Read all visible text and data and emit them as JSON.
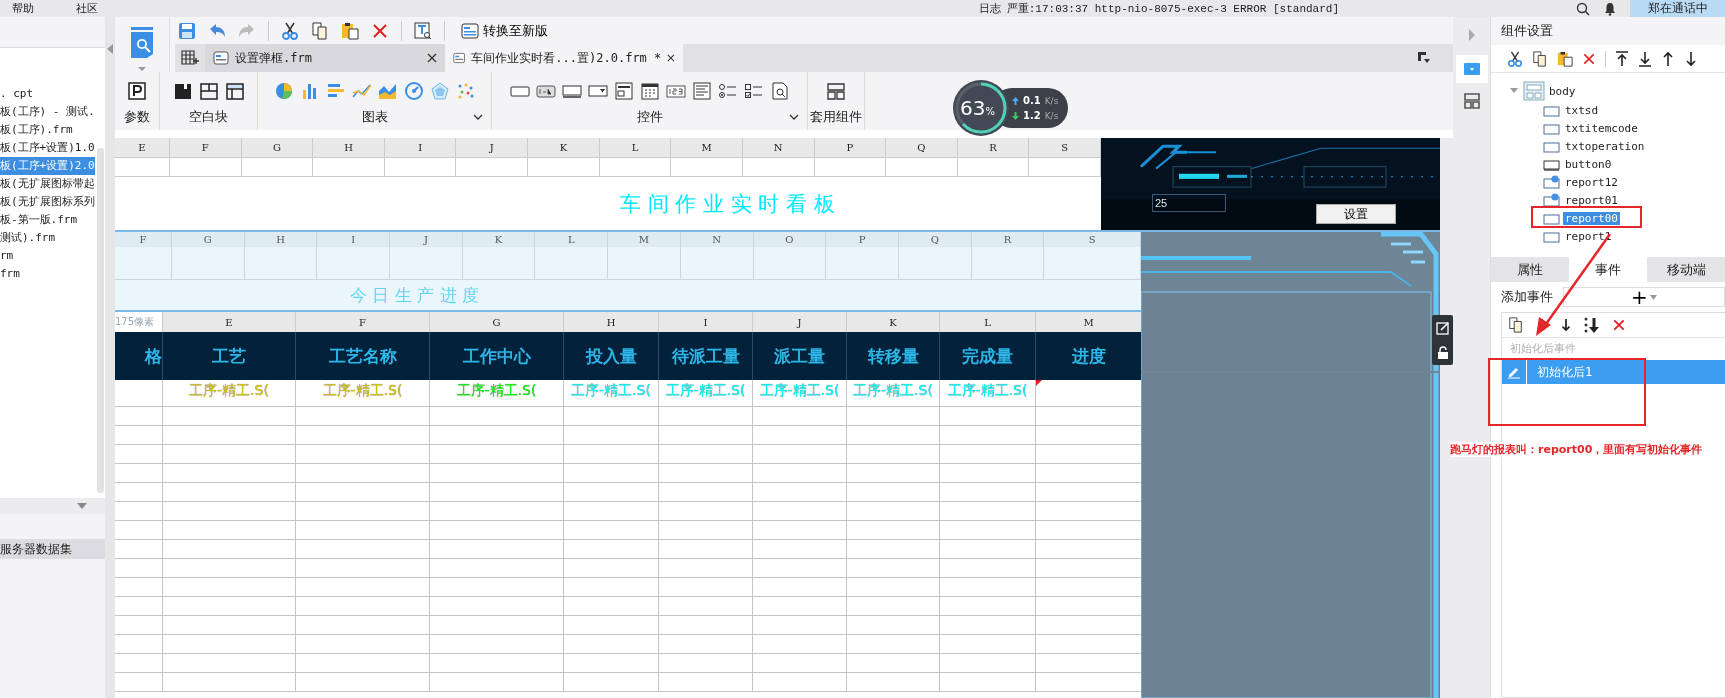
{
  "menu": [
    {
      "label": "帮助"
    },
    {
      "label": "社区"
    }
  ],
  "status_bar": {
    "log": "日志",
    "message": "严重:17:03:37 http-nio-8075-exec-3 ERROR [standard]",
    "call": "郑在通话中"
  },
  "file_tree": {
    "items": [
      {
        "label": ". cpt",
        "selected": false
      },
      {
        "label": "板(工序) - 测试.",
        "selected": false
      },
      {
        "label": "板(工序).frm",
        "selected": false
      },
      {
        "label": "板(工序+设置)1.0",
        "selected": false
      },
      {
        "label": "板(工序+设置)2.0",
        "selected": true
      },
      {
        "label": "板(无扩展图标带起",
        "selected": false
      },
      {
        "label": "板(无扩展图标系列",
        "selected": false
      },
      {
        "label": "板-第一版.frm",
        "selected": false
      },
      {
        "label": "测试).frm",
        "selected": false
      },
      {
        "label": "rm",
        "selected": false
      },
      {
        "label": "frm",
        "selected": false
      }
    ],
    "section": "服务器数据集"
  },
  "toolbar": {
    "convert_button": "转换至新版"
  },
  "tabs": [
    {
      "label": "设置弹框.frm",
      "selected": false
    },
    {
      "label": "车间作业实时看...置)2.0.frm *",
      "selected": true
    }
  ],
  "ribbon": [
    {
      "kind": "param",
      "label": "参数",
      "expandable": false
    },
    {
      "kind": "blank",
      "label": "空白块",
      "expandable": false
    },
    {
      "kind": "chart",
      "label": "图表",
      "expandable": true
    },
    {
      "kind": "widget",
      "label": "控件",
      "expandable": true
    },
    {
      "kind": "template",
      "label": "套用组件",
      "expandable": false
    }
  ],
  "network_meter": {
    "percent": "63",
    "unit": "%",
    "upload": "0.1",
    "upload_unit": "K/s",
    "download": "1.2",
    "download_unit": "K/s"
  },
  "sheet": {
    "banner_block": {
      "columns": [
        "E",
        "F",
        "G",
        "H",
        "I",
        "J",
        "K",
        "L",
        "M",
        "N",
        "P",
        "Q",
        "R",
        "S"
      ],
      "title": "车 间 作 业 实 时 看 板",
      "input_value": "25",
      "button": "设置"
    },
    "progress_block": {
      "columns": [
        "F",
        "G",
        "H",
        "I",
        "J",
        "K",
        "L",
        "M",
        "N",
        "O",
        "P",
        "Q",
        "R",
        "S"
      ],
      "title": "今 日 生 产 进 度"
    },
    "table_block": {
      "height_label": "175像素",
      "columns": [
        "E",
        "F",
        "G",
        "H",
        "I",
        "J",
        "K",
        "L",
        "M"
      ],
      "headers": [
        "格",
        "工艺",
        "工艺名称",
        "工作中心",
        "投入量",
        "待派工量",
        "派工量",
        "转移量",
        "完成量",
        "进度"
      ],
      "row": [
        {
          "text": "工序-精工.S(",
          "color": "#d8c800"
        },
        {
          "text": "工序-精工.S(",
          "color": "#d8c800"
        },
        {
          "text": "工序-精工.S(",
          "color": "#00ff00"
        },
        {
          "text": "工序-精工.S(",
          "color": "#00ffff"
        },
        {
          "text": "工序-精工.S(",
          "color": "#00ffff"
        },
        {
          "text": "工序-精工.S(",
          "color": "#00ffff"
        },
        {
          "text": "工序-精工.S(",
          "color": "#00ffff"
        },
        {
          "text": "工序-精工.S(",
          "color": "#00ffff"
        }
      ]
    }
  },
  "component_panel": {
    "title": "组件设置",
    "tree": [
      {
        "label": "body",
        "expanded": true,
        "children": [
          {
            "label": "txtsd",
            "kind": "field",
            "linked": false,
            "selected": false
          },
          {
            "label": "txtitemcode",
            "kind": "field",
            "linked": false,
            "selected": false
          },
          {
            "label": "txtoperation",
            "kind": "field",
            "linked": false,
            "selected": false
          },
          {
            "label": "button0",
            "kind": "button",
            "linked": false,
            "selected": false
          },
          {
            "label": "report12",
            "kind": "field",
            "linked": true,
            "selected": false
          },
          {
            "label": "report01",
            "kind": "field",
            "linked": true,
            "selected": false
          },
          {
            "label": "report00",
            "kind": "field",
            "linked": false,
            "selected": true
          },
          {
            "label": "report1",
            "kind": "field",
            "linked": false,
            "selected": false
          }
        ]
      }
    ],
    "tabs": [
      {
        "label": "属性",
        "selected": false
      },
      {
        "label": "事件",
        "selected": true
      },
      {
        "label": "移动端",
        "selected": false
      }
    ],
    "add_event_label": "添加事件",
    "add_event_button": "+",
    "event_group": "初始化后事件",
    "events": [
      {
        "label": "初始化后1",
        "selected": true
      }
    ]
  },
  "annotation": {
    "text": "跑马灯的报表叫：report00，里面有写初始化事件"
  }
}
